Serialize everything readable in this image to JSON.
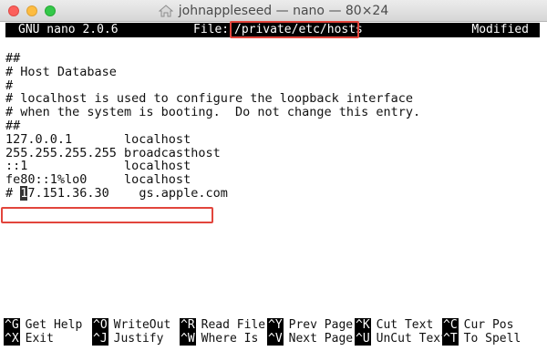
{
  "window": {
    "title": "johnappleseed — nano — 80×24",
    "traffic_lights": [
      "close",
      "minimize",
      "zoom"
    ],
    "title_icon": "home-icon"
  },
  "nano": {
    "version": "GNU nano 2.0.6",
    "file_label": "File:",
    "file_path": "/private/etc/hosts",
    "status": "Modified"
  },
  "buffer": {
    "lines": [
      "##",
      "# Host Database",
      "#",
      "# localhost is used to configure the loopback interface",
      "# when the system is booting.  Do not change this entry.",
      "##",
      "127.0.0.1       localhost",
      "255.255.255.255 broadcasthost",
      "::1             localhost",
      "fe80::1%lo0     localhost"
    ],
    "edited_line": {
      "before_cursor": "# ",
      "cursor_char": "1",
      "after_cursor": "7.151.36.30    gs.apple.com"
    }
  },
  "shortcuts": {
    "row1": [
      {
        "key": "^G",
        "label": "Get Help"
      },
      {
        "key": "^O",
        "label": "WriteOut"
      },
      {
        "key": "^R",
        "label": "Read File"
      },
      {
        "key": "^Y",
        "label": "Prev Page"
      },
      {
        "key": "^K",
        "label": "Cut Text"
      },
      {
        "key": "^C",
        "label": "Cur Pos"
      }
    ],
    "row2": [
      {
        "key": "^X",
        "label": "Exit"
      },
      {
        "key": "^J",
        "label": "Justify"
      },
      {
        "key": "^W",
        "label": "Where Is"
      },
      {
        "key": "^V",
        "label": "Next Page"
      },
      {
        "key": "^U",
        "label": "UnCut Text"
      },
      {
        "key": "^T",
        "label": "To Spell"
      }
    ]
  },
  "colors": {
    "highlight": "#e2453c",
    "terminal_bg": "#ffffff",
    "header_bg": "#000000"
  }
}
